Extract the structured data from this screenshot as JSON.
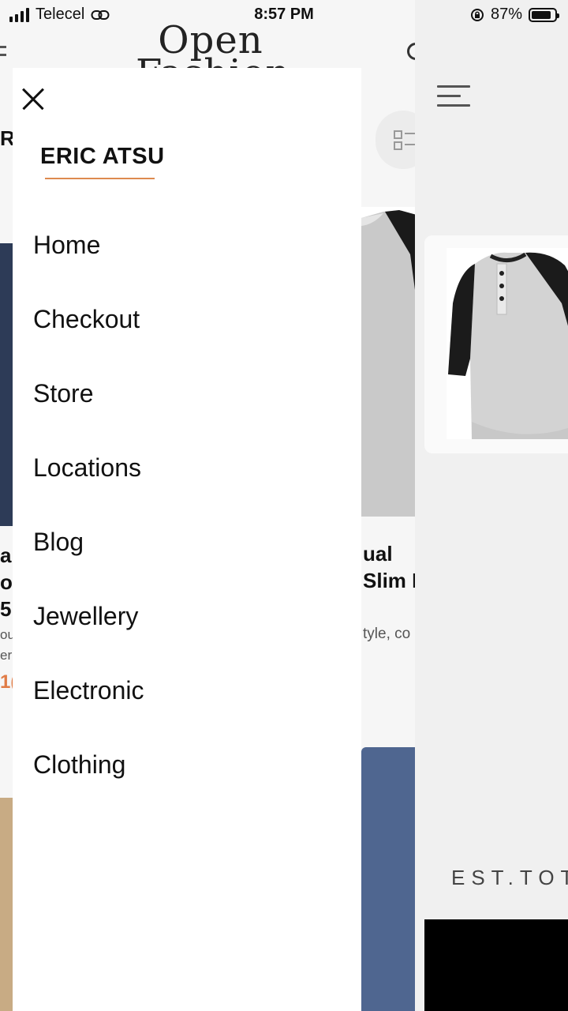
{
  "status_bar": {
    "carrier": "Telecel",
    "time": "8:57 PM",
    "battery": "87%",
    "battery_level": 0.87
  },
  "background_page": {
    "logo_line1": "Open",
    "logo_line2": "Fashion",
    "cut_letter": "R",
    "left_product": {
      "title_lines": [
        "a",
        "o",
        "5"
      ],
      "desc_lines": [
        "ou",
        "er"
      ],
      "price": "1("
    },
    "right_product": {
      "title_line1": "ual",
      "title_line2": "Slim I",
      "desc": "tyle, co"
    }
  },
  "right_panel": {
    "brand_text": "EST.TOT"
  },
  "drawer": {
    "user_name": "ERIC ATSU",
    "menu_items": [
      {
        "label": "Home"
      },
      {
        "label": "Checkout"
      },
      {
        "label": "Store"
      },
      {
        "label": "Locations"
      },
      {
        "label": "Blog"
      },
      {
        "label": "Jewellery"
      },
      {
        "label": "Electronic"
      },
      {
        "label": "Clothing"
      }
    ]
  },
  "colors": {
    "accent": "#dd8a4f"
  }
}
